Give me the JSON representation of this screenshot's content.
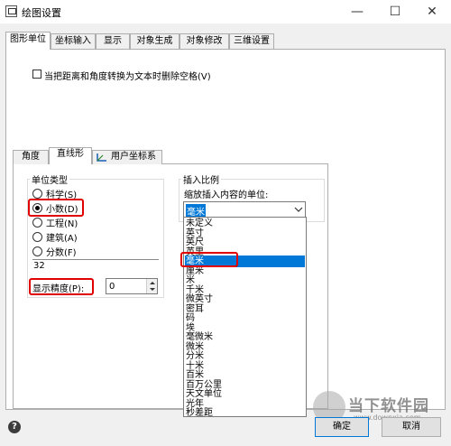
{
  "window": {
    "title": "绘图设置",
    "minimize": "—",
    "maximize": "☐",
    "close": "✕"
  },
  "tabs": [
    "图形单位",
    "坐标输入",
    "显示",
    "对象生成",
    "对象修改",
    "三维设置"
  ],
  "active_tab": 0,
  "checkbox_label": "当把距离和角度转换为文本时删除空格(V)",
  "inner_tabs": [
    "角度",
    "直线形",
    "用户坐标系"
  ],
  "active_inner_tab": 1,
  "unit_type": {
    "legend": "单位类型",
    "options": [
      "科学(S)",
      "小数(D)",
      "工程(N)",
      "建筑(A)",
      "分数(F)"
    ],
    "selected": 1,
    "sample": "32",
    "precision_label": "显示精度(P):",
    "precision_value": "0"
  },
  "insert_scale": {
    "legend": "插入比例",
    "scale_label": "缩放插入内容的单位:",
    "selected_value": "毫米",
    "options": [
      "未定义",
      "英寸",
      "英尺",
      "英里",
      "毫米",
      "厘米",
      "米",
      "千米",
      "微英寸",
      "密耳",
      "码",
      "埃",
      "毫微米",
      "微米",
      "分米",
      "十米",
      "百米",
      "百万公里",
      "天文单位",
      "光年",
      "秒差距"
    ],
    "selected_index": 4
  },
  "buttons": {
    "ok": "确定",
    "cancel": "取消"
  },
  "watermark": {
    "brand": "当下软件园",
    "url": "www.downxia.com"
  },
  "colors": {
    "highlight_red": "#e00000",
    "selection_blue": "#0078d7"
  }
}
